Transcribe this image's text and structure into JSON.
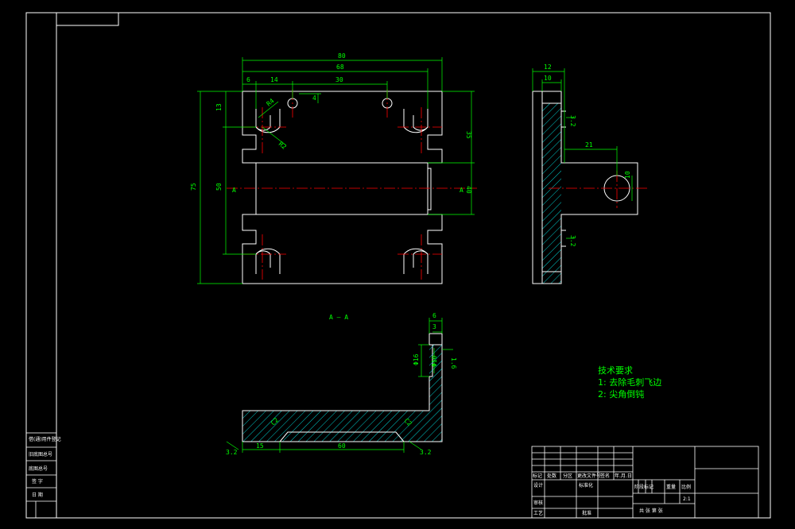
{
  "colors": {
    "background": "#000000",
    "outline": "#ffffff",
    "dimension": "#00ff00",
    "centerline": "#ff0000",
    "hatch": "#00ffff"
  },
  "front_view": {
    "dims": {
      "overall_width": "80",
      "slot_span": "68",
      "edge_offset": "6",
      "hole_offset": "14",
      "hole_spacing": "30",
      "hole_depth": "4",
      "top_height": "13",
      "right_height": "35",
      "overall_height": "75",
      "inner_height": "50",
      "slot_width": "40",
      "radius_1": "R4",
      "radius_2": "R2"
    },
    "section_mark_left": "A",
    "section_mark_right": "A"
  },
  "side_view": {
    "dims": {
      "top_width": "12",
      "plate_thickness": "10",
      "boss_length": "21",
      "hole_diameter": "10",
      "roughness_1": "3.2",
      "roughness_2": "3.2"
    }
  },
  "section_view": {
    "label": "A — A",
    "dims": {
      "top_width": "6",
      "inner_width": "3",
      "dia_outer": "Φ16",
      "dia_inner": "Φ10",
      "roughness_top": "1.6",
      "bottom_left": "15",
      "bottom_slot": "60",
      "chamfer_left": "C2",
      "chamfer_right": "C2",
      "roughness_left": "3.2",
      "roughness_right": "3.2"
    }
  },
  "technical_requirements": {
    "heading": "技术要求",
    "items": [
      "1: 去除毛刺飞边",
      "2: 尖角倒钝"
    ]
  },
  "left_strip": {
    "rows": [
      "借(通)用件登记",
      "旧底图总号",
      "底图总号",
      "签 字",
      "日 期"
    ]
  },
  "title_block": {
    "header_row": [
      "标记",
      "处数",
      "分区",
      "更改文件号",
      "签名",
      "年.月.日"
    ],
    "design_row": [
      "设计",
      "标准化"
    ],
    "review_label": "审核",
    "process_label": "工艺",
    "approve_label": "批准",
    "stage_label": "阶段标记",
    "weight_label": "重量",
    "scale_label": "比例",
    "scale_value": "2:1",
    "sheet_label": "共 张 第 张"
  }
}
